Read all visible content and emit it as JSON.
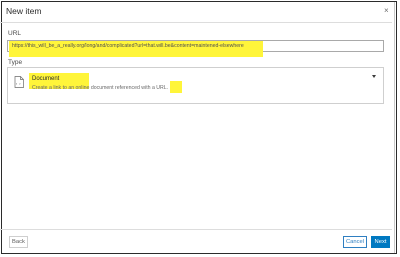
{
  "dialog": {
    "title": "New item",
    "close_glyph": "×"
  },
  "url_section": {
    "label": "URL",
    "value": "https://this_will_be_a_really.org/long/and/complicated?url=that.will.be&content=maintened-elsewhere"
  },
  "type_section": {
    "label": "Type",
    "selected": {
      "icon": "document-icon",
      "title": "Document",
      "description": "Create a link to an online document referenced with a URL."
    }
  },
  "footer": {
    "back_label": "Back",
    "cancel_label": "Cancel",
    "next_label": "Next"
  },
  "colors": {
    "highlight": "#fff53a",
    "accent": "#0079c1"
  }
}
